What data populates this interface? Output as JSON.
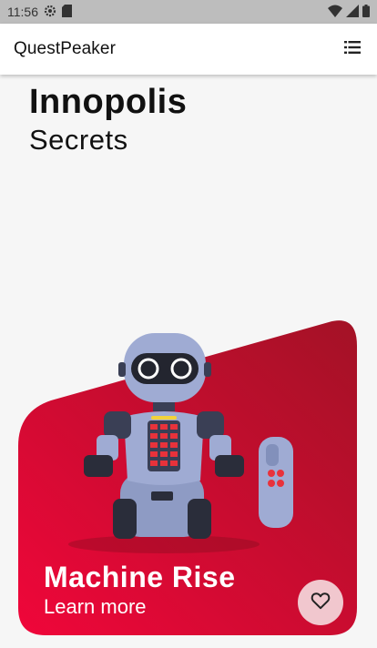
{
  "status_bar": {
    "time": "11:56",
    "icons": [
      "settings-gear-icon",
      "sd-card-icon",
      "wifi-icon",
      "cellular-signal-icon",
      "battery-icon"
    ]
  },
  "app_bar": {
    "title": "QuestPeaker",
    "menu_icon": "list-icon"
  },
  "heading": {
    "title": "Innopolis",
    "subtitle": "Secrets"
  },
  "card": {
    "title": "Machine Rise",
    "link": "Learn more",
    "gradient_colors": [
      "#f0063a",
      "#a31226"
    ],
    "image": "robot-illustration",
    "favorite_icon": "heart-outline-icon"
  },
  "colors": {
    "background": "#f6f6f6",
    "status_bar": "#bdbdbd",
    "accent_red": "#e8083a",
    "favorite_button": "#f1c7ce"
  }
}
